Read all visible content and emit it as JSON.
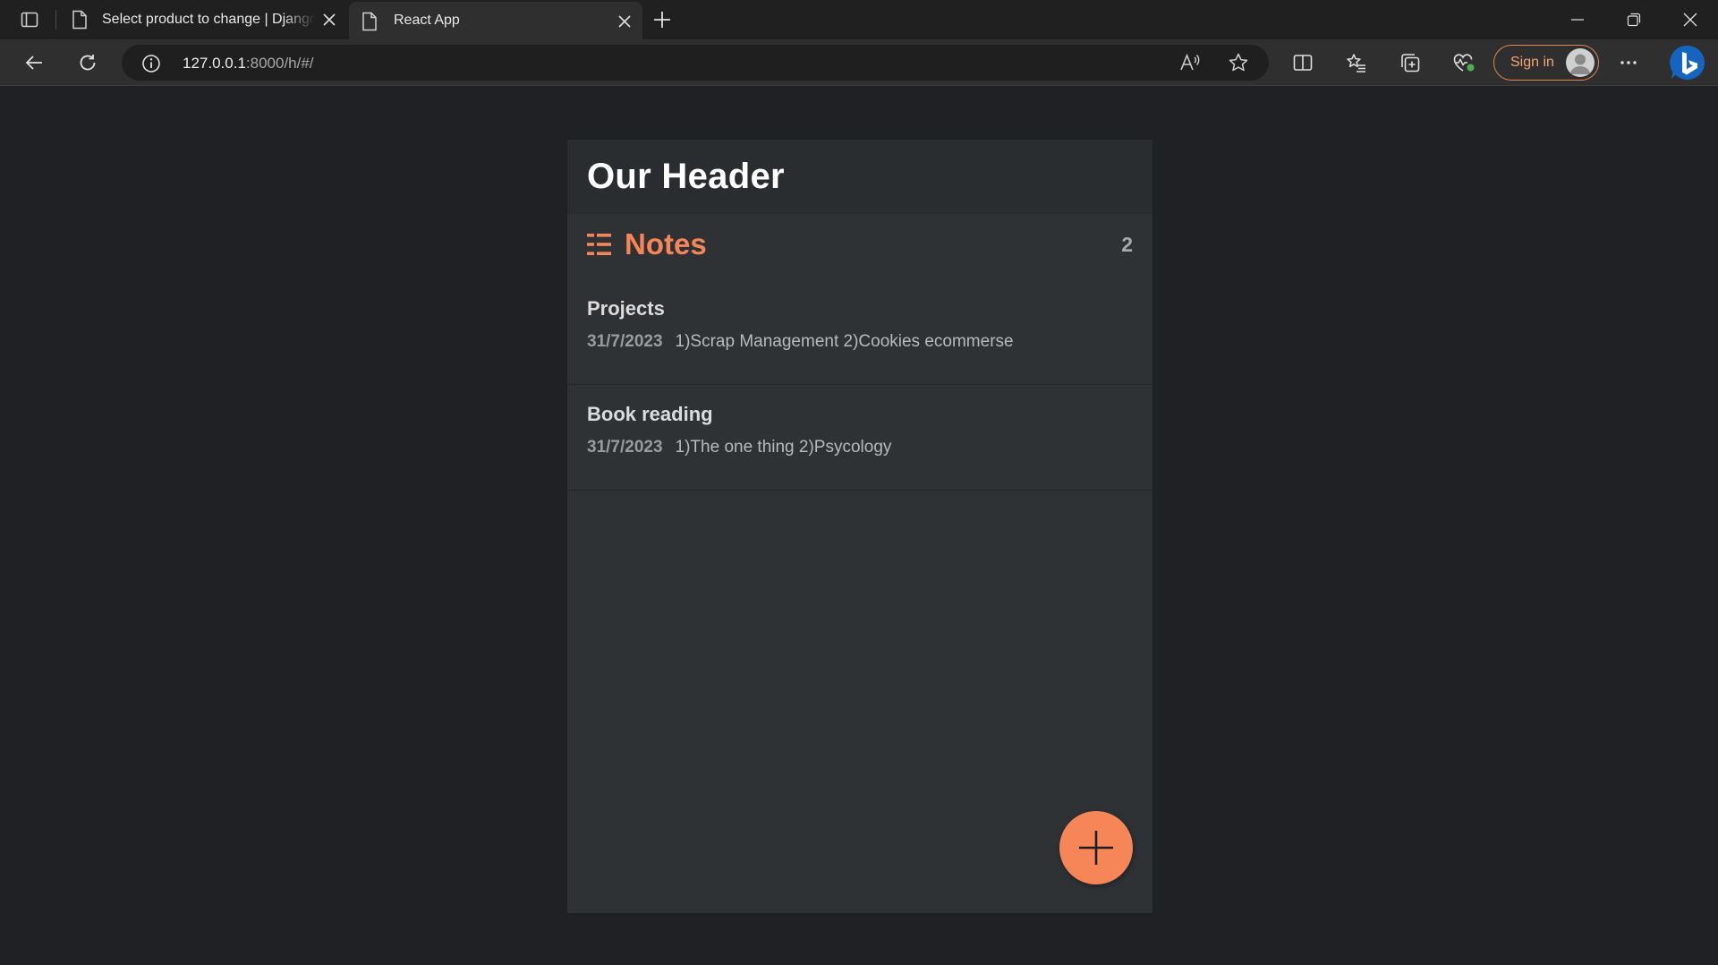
{
  "browser": {
    "tabs": [
      {
        "title": "Select product to change | Django site admin"
      },
      {
        "title": "React App"
      }
    ],
    "url_host": "127.0.0.1",
    "url_path": ":8000/h/#/",
    "signin_label": "Sign in"
  },
  "app": {
    "header": "Our Header",
    "notes_title": "Notes",
    "notes_count": "2",
    "notes": [
      {
        "title": "Projects",
        "date": "31/7/2023",
        "body": "1)Scrap Management 2)Cookies ecommerse"
      },
      {
        "title": "Book reading",
        "date": "31/7/2023",
        "body": "1)The one thing 2)Psycology"
      }
    ]
  },
  "colors": {
    "accent": "#f68657",
    "page_bg": "#202124",
    "card_bg": "#2e3235",
    "header_bg": "#2a2d30"
  },
  "icons": {
    "notes": "list-icon",
    "fab": "plus-icon"
  }
}
